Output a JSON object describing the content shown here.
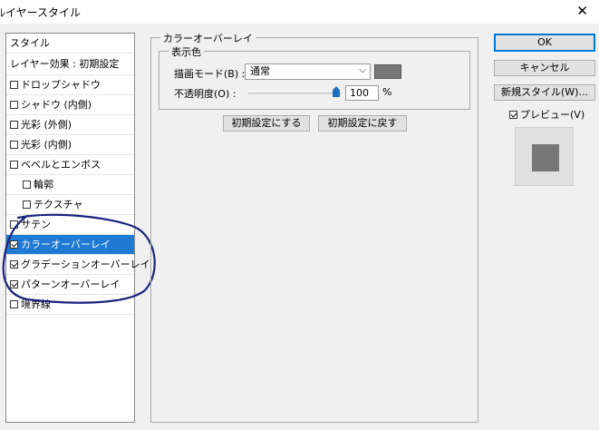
{
  "window": {
    "title": "ﾚイヤースタイル"
  },
  "icons": {
    "close": "close-icon"
  },
  "style_list": {
    "header": "スタイル",
    "effects_label": "レイヤー効果 : 初期設定",
    "items": [
      {
        "label": "ドロップシャドウ",
        "checked": false,
        "indent": false,
        "selected": false
      },
      {
        "label": "シャドウ (内側)",
        "checked": false,
        "indent": false,
        "selected": false
      },
      {
        "label": "光彩 (外側)",
        "checked": false,
        "indent": false,
        "selected": false
      },
      {
        "label": "光彩 (内側)",
        "checked": false,
        "indent": false,
        "selected": false
      },
      {
        "label": "ベベルとエンボス",
        "checked": false,
        "indent": false,
        "selected": false
      },
      {
        "label": "輪郭",
        "checked": false,
        "indent": true,
        "selected": false
      },
      {
        "label": "テクスチャ",
        "checked": false,
        "indent": true,
        "selected": false
      },
      {
        "label": "サテン",
        "checked": false,
        "indent": false,
        "selected": false
      },
      {
        "label": "カラーオーバーレイ",
        "checked": true,
        "indent": false,
        "selected": true
      },
      {
        "label": "グラデーションオーバーレイ",
        "checked": true,
        "indent": false,
        "selected": false
      },
      {
        "label": "パターンオーバーレイ",
        "checked": true,
        "indent": false,
        "selected": false
      },
      {
        "label": "境界線",
        "checked": false,
        "indent": false,
        "selected": false
      }
    ]
  },
  "panel": {
    "title": "カラーオーバーレイ",
    "section_title": "表示色",
    "blend_mode_label": "描画モード(B) :",
    "blend_mode_value": "通常",
    "overlay_color": "#777777",
    "opacity_label": "不透明度(O) :",
    "opacity_value": "100",
    "opacity_unit": "%",
    "make_default_button": "初期設定にする",
    "reset_default_button": "初期設定に戻す"
  },
  "actions": {
    "ok": "OK",
    "cancel": "キャンセル",
    "new_style": "新規スタイル(W)...",
    "preview_label": "プレビュー(V)",
    "preview_checked": true
  },
  "colors": {
    "selection": "#1e7ad5",
    "annotation_stroke": "#1a237e",
    "primary_border": "#0078d7"
  }
}
